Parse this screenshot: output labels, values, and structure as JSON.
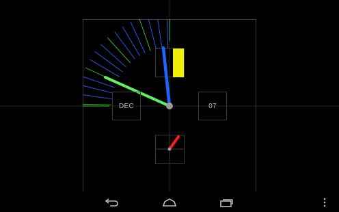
{
  "clock": {
    "month_label": "DEC",
    "day_label": "07"
  },
  "colors": {
    "background": "#000000",
    "frame": "#3a3a3a",
    "hour_hand": "#1e66ff",
    "minute_hand": "#5ef05e",
    "second_hand": "#ff1a1a",
    "marker": "#f0f000",
    "pivot": "#9a9a9a",
    "sweep_green": "#2bd02b",
    "sweep_blue": "#2e5cff"
  },
  "navbar": {
    "back_icon": "back-arrow-icon",
    "home_icon": "home-icon",
    "recents_icon": "recent-apps-icon",
    "menu_icon": "overflow-menu-icon"
  }
}
